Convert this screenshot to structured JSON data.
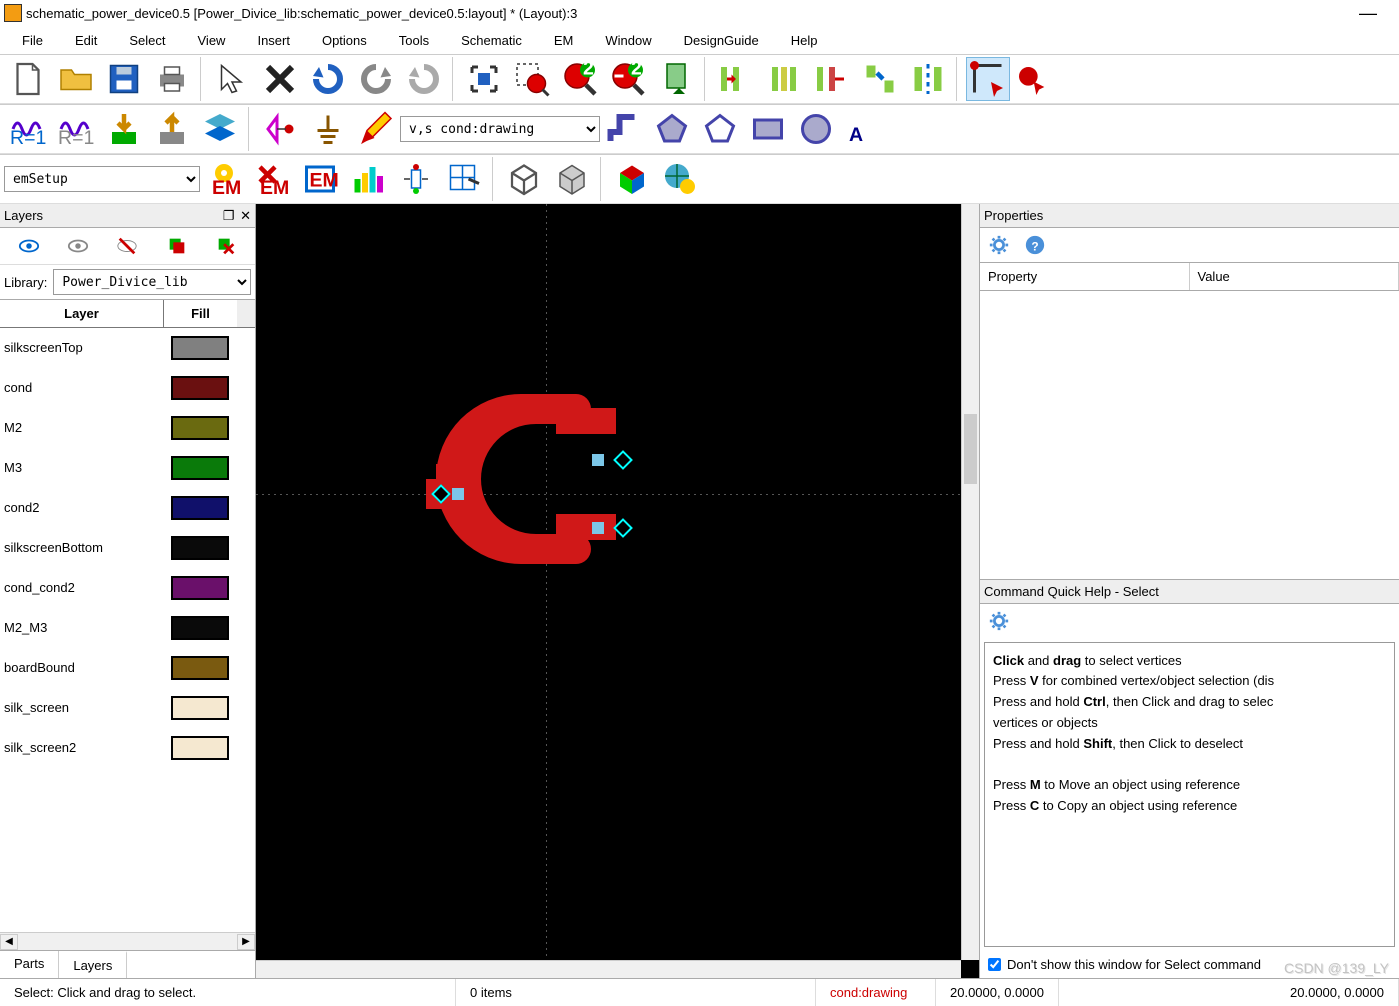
{
  "title": "schematic_power_device0.5 [Power_Divice_lib:schematic_power_device0.5:layout] * (Layout):3",
  "menu": [
    "File",
    "Edit",
    "Select",
    "View",
    "Insert",
    "Options",
    "Tools",
    "Schematic",
    "EM",
    "Window",
    "DesignGuide",
    "Help"
  ],
  "emSetup": "emSetup",
  "layerCombo": "v,s cond:drawing",
  "layersPanel": {
    "title": "Layers",
    "libraryLabel": "Library:",
    "library": "Power_Divice_lib",
    "headLayer": "Layer",
    "headFill": "Fill",
    "layers": [
      {
        "name": "silkscreenTop",
        "color": "#808080"
      },
      {
        "name": "cond",
        "color": "#6a1010"
      },
      {
        "name": "M2",
        "color": "#6a6a10"
      },
      {
        "name": "M3",
        "color": "#0a7a0a"
      },
      {
        "name": "cond2",
        "color": "#10106a"
      },
      {
        "name": "silkscreenBottom",
        "color": "#0a0a0a"
      },
      {
        "name": "cond_cond2",
        "color": "#6a106a"
      },
      {
        "name": "M2_M3",
        "color": "#0a0a0a"
      },
      {
        "name": "boardBound",
        "color": "#7a5a10"
      },
      {
        "name": "silk_screen",
        "color": "#f5e8d0"
      },
      {
        "name": "silk_screen2",
        "color": "#f5e8d0"
      }
    ],
    "tabs": [
      "Parts",
      "Layers"
    ]
  },
  "properties": {
    "title": "Properties",
    "col1": "Property",
    "col2": "Value"
  },
  "quickhelp": {
    "title": "Command Quick Help - Select",
    "lines": [
      {
        "pre": "",
        "b": "Click",
        "post": " and ",
        "b2": "drag",
        "post2": " to select vertices"
      },
      {
        "pre": "Press ",
        "b": "V",
        "post": " for combined vertex/object selection (dis"
      },
      {
        "pre": "Press and hold ",
        "b": "Ctrl",
        "post": ", then Click and drag to selec"
      },
      {
        "pre": "vertices or objects"
      },
      {
        "pre": "Press and hold ",
        "b": "Shift",
        "post": ", then Click to deselect"
      },
      {
        "pre": ""
      },
      {
        "pre": "Press ",
        "b": "M",
        "post": " to Move an object using reference"
      },
      {
        "pre": "Press ",
        "b": "C",
        "post": " to Copy an object using reference"
      }
    ],
    "checkbox": "Don't show this window for Select command"
  },
  "status": {
    "select": "Select: Click and drag to select.",
    "items": "0 items",
    "layer": "cond:drawing",
    "coord1": "20.0000, 0.0000",
    "coord2": "20.0000, 0.0000"
  },
  "watermark": "CSDN @139_LY"
}
